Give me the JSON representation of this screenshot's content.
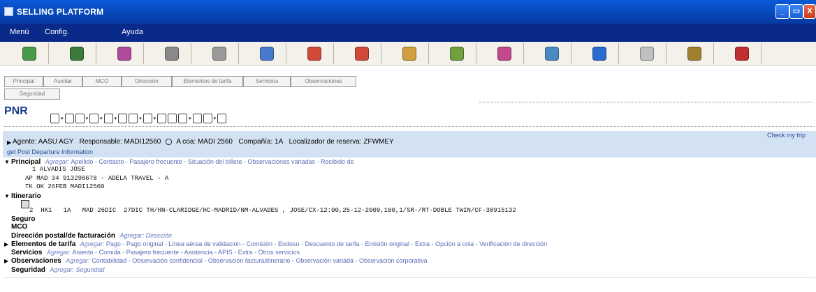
{
  "window": {
    "title": "SELLING PLATFORM",
    "buttons": [
      "_",
      "▭",
      "X"
    ]
  },
  "menu": [
    "Menú",
    "Config.",
    "Ayuda"
  ],
  "toolbar_icons": [
    {
      "name": "cube-icon",
      "color": "#4a9a4a"
    },
    {
      "name": "book-icon",
      "color": "#3a7a3a"
    },
    {
      "name": "globe-person-icon",
      "color": "#b04a9a"
    },
    {
      "name": "tools-icon",
      "color": "#8a8a8a"
    },
    {
      "name": "airplane-icon",
      "color": "#9a9a9a"
    },
    {
      "name": "car-icon",
      "color": "#4a7ad0"
    },
    {
      "name": "bellboy-icon",
      "color": "#d04a3a"
    },
    {
      "name": "bellboy-luggage-icon",
      "color": "#d04a3a"
    },
    {
      "name": "parasol-icon",
      "color": "#d0a040"
    },
    {
      "name": "map-icon",
      "color": "#70a040"
    },
    {
      "name": "ticket-icon",
      "color": "#c04a8a"
    },
    {
      "name": "documents-icon",
      "color": "#4a8ac0"
    },
    {
      "name": "info-icon",
      "color": "#2a6ad0"
    },
    {
      "name": "cake-icon",
      "color": "#c0c0c0"
    },
    {
      "name": "money-icon",
      "color": "#a08030"
    },
    {
      "name": "building-icon",
      "color": "#c03030"
    }
  ],
  "tabs": [
    "Principal",
    "Auxiliar",
    "MCO",
    "Dirección",
    "Elementos de tarifa",
    "Servicios",
    "Observaciones",
    "Seguridad"
  ],
  "pnr": {
    "label": "PNR",
    "agent_line": {
      "agente": "Agente: AASU AGY",
      "responsable": "Responsable: MADI12560",
      "acoa": "A coa: MADI 2560",
      "compania": "Compañía: 1A",
      "localizador": "Localizador de reserva: ZFWMEY"
    },
    "post_departure": "get Post Departure Information",
    "check_my_trip": "Check my trip"
  },
  "sections": {
    "principal": {
      "title": "Principal",
      "agregar": "Agregar:",
      "links": "Apellido - Contacto - Pasajero frecuente - Situación del billete - Observaciones variadas - Recibido de",
      "lines": [
        "1 ALVADIS JOSE",
        "AP MAD 34 913298678 - ADELA TRAVEL - A",
        "TK OK 26FEB MADI12560"
      ]
    },
    "itinerario": {
      "title": "Itinerario",
      "segment": "2  HK1   1A   MAD 26DIC  27DIC TH/HN-CLARIDGE/HC-MADRID/NM-ALVADES , JOSE/CX-12:00,25-12-2009,100,1/SR-/RT-DOBLE TWIN/CF-30915132"
    },
    "seguro": {
      "title": "Seguro"
    },
    "mco": {
      "title": "MCO"
    },
    "direccion": {
      "title": "Dirección postal/de facturación",
      "agregar": "Agregar: Dirección"
    },
    "tarifa": {
      "title": "Elementos de tarifa",
      "agregar": "Agregar:",
      "links": "Pago - Pago original - Línea aérea de validación - Comisión - Endoso - Descuento de tarifa - Emisión original - Extra - Opción a cola - Verificación de dirección"
    },
    "servicios": {
      "title": "Servicios",
      "agregar": "Agregar:",
      "links": "Asiento - Comida - Pasajero frecuente - Asistencia - APIS - Extra - Otros servicios"
    },
    "observaciones": {
      "title": "Observaciones",
      "agregar": "Agregar:",
      "links": "Contabilidad - Observación confidencial - Observación factura/itinerario - Observación variada - Observación corporativa"
    },
    "seguridad": {
      "title": "Seguridad",
      "agregar": "Agregar: Seguridad"
    }
  }
}
